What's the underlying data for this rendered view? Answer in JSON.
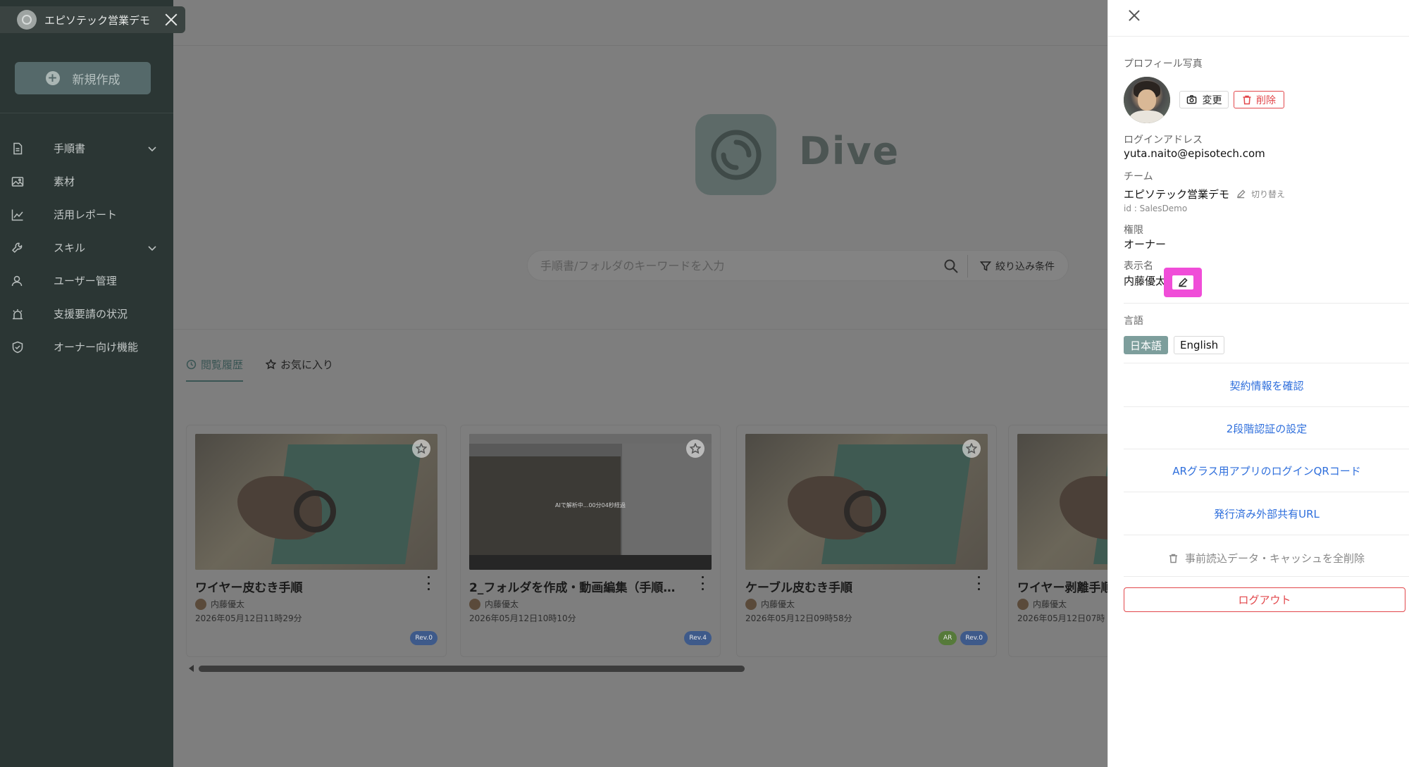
{
  "sidebar": {
    "team_name": "エピソテック営業デモ",
    "new_button_label": "新規作成",
    "items": [
      {
        "label": "手順書",
        "icon": "document-icon",
        "has_chevron": true
      },
      {
        "label": "素材",
        "icon": "image-icon",
        "has_chevron": false
      },
      {
        "label": "活用レポート",
        "icon": "chart-icon",
        "has_chevron": false
      },
      {
        "label": "スキル",
        "icon": "wrench-icon",
        "has_chevron": true
      },
      {
        "label": "ユーザー管理",
        "icon": "users-icon",
        "has_chevron": false
      },
      {
        "label": "支援要請の状況",
        "icon": "alarm-icon",
        "has_chevron": false
      },
      {
        "label": "オーナー向け機能",
        "icon": "shield-icon",
        "has_chevron": false
      }
    ]
  },
  "main": {
    "brand": "Dive",
    "search": {
      "placeholder": "手順書/フォルダのキーワードを入力",
      "filter_label": "絞り込み条件"
    },
    "tabs": [
      {
        "label": "閲覧履歴",
        "icon": "history-icon",
        "active": true
      },
      {
        "label": "お気に入り",
        "icon": "star-icon",
        "active": false
      }
    ],
    "cards": [
      {
        "title": "ワイヤー皮むき手順",
        "author": "内藤優太",
        "date": "2026年05月12日11時29分",
        "badges": [
          "Rev.0"
        ],
        "thumb": "photo"
      },
      {
        "title": "2_フォルダを作成・動画編集（手順…",
        "author": "内藤優太",
        "date": "2026年05月12日10時10分",
        "badges": [
          "Rev.4"
        ],
        "thumb": "screen",
        "overlay_text": "AIで解析中...00分04秒経過"
      },
      {
        "title": "ケーブル皮むき手順",
        "author": "内藤優太",
        "date": "2026年05月12日09時58分",
        "badges": [
          "AR",
          "Rev.0"
        ],
        "thumb": "photo"
      },
      {
        "title": "ワイヤー剥離手順",
        "author": "内藤優太",
        "date": "2026年05月12日07時",
        "badges": [],
        "thumb": "photo"
      }
    ]
  },
  "panel": {
    "photo_label": "プロフィール写真",
    "change_label": "変更",
    "delete_label": "削除",
    "login_label": "ログインアドレス",
    "login_value": "yuta.naito@episotech.com",
    "team_label": "チーム",
    "team_value": "エピソテック営業デモ",
    "team_switch": "切り替え",
    "team_id": "id : SalesDemo",
    "role_label": "権限",
    "role_value": "オーナー",
    "display_name_label": "表示名",
    "display_name_value": "内藤優太",
    "language_label": "言語",
    "languages": [
      "日本語",
      "English"
    ],
    "links": [
      "契約情報を確認",
      "2段階認証の設定",
      "ARグラス用アプリのログインQRコード",
      "発行済み外部共有URL"
    ],
    "cache_clear": "事前読込データ・キャッシュを全削除",
    "logout": "ログアウト",
    "highlight_color": "#f04dd8"
  }
}
